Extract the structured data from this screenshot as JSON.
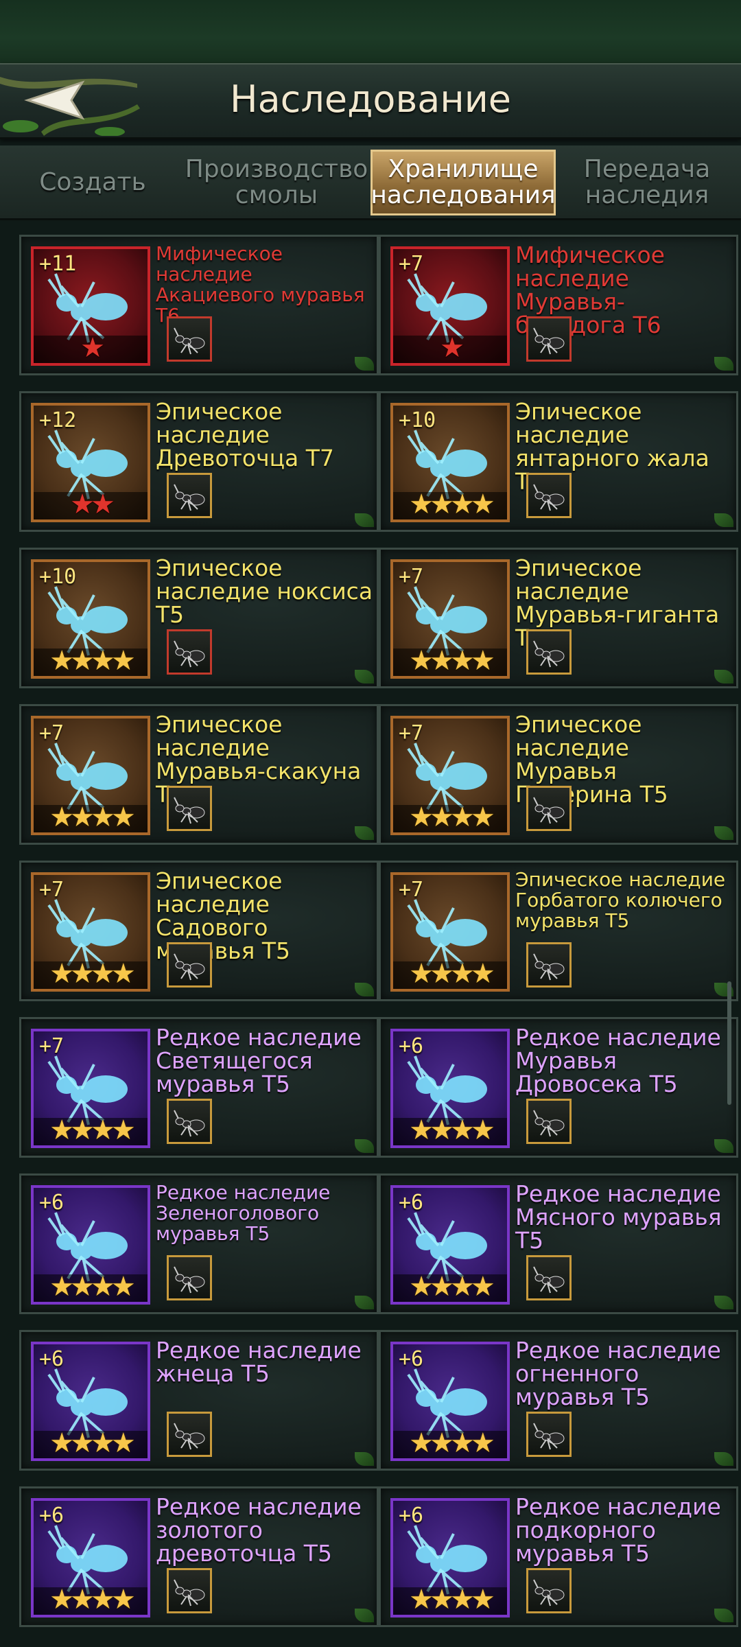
{
  "header": {
    "title": "Наследование",
    "back_icon": "back-arrow-icon"
  },
  "tabs": [
    {
      "label": "Создать",
      "active": false
    },
    {
      "label": "Производство смолы",
      "active": false
    },
    {
      "label": "Хранилище наследования",
      "active": true
    },
    {
      "label": "Передача наследия",
      "active": false
    }
  ],
  "colors": {
    "mythic": "#e13a35",
    "epic": "#f3e36a",
    "rare": "#dea3ff",
    "star_gold": "#f7c64a",
    "star_red": "#e0342c"
  },
  "items": [
    {
      "name": "Мифическое наследие Акациевого муравья Т6",
      "level": "+11",
      "rarity": "mythic",
      "stars": 1,
      "star_color": "red"
    },
    {
      "name": "Мифическое наследие Муравья-бульдога Т6",
      "level": "+7",
      "rarity": "mythic",
      "stars": 1,
      "star_color": "red"
    },
    {
      "name": "Эпическое наследие Древоточца Т7",
      "level": "+12",
      "rarity": "epic",
      "stars": 2,
      "star_color": "red"
    },
    {
      "name": "Эпическое наследие янтарного жала Т5",
      "level": "+10",
      "rarity": "epic",
      "stars": 4,
      "star_color": "gold"
    },
    {
      "name": "Эпическое наследие ноксиса Т5",
      "level": "+10",
      "rarity": "epic",
      "stars": 4,
      "star_color": "gold"
    },
    {
      "name": "Эпическое наследие Муравья-гиганта Т5",
      "level": "+7",
      "rarity": "epic",
      "stars": 4,
      "star_color": "gold"
    },
    {
      "name": "Эпическое наследие Муравья-скакуна Т5",
      "level": "+7",
      "rarity": "epic",
      "stars": 4,
      "star_color": "gold"
    },
    {
      "name": "Эпическое наследие Муравья Понерина Т5",
      "level": "+7",
      "rarity": "epic",
      "stars": 4,
      "star_color": "gold"
    },
    {
      "name": "Эпическое наследие Садового муравья Т5",
      "level": "+7",
      "rarity": "epic",
      "stars": 4,
      "star_color": "gold"
    },
    {
      "name": "Эпическое наследие Горбатого колючего муравья Т5",
      "level": "+7",
      "rarity": "epic",
      "stars": 4,
      "star_color": "gold"
    },
    {
      "name": "Редкое наследие Светящегося муравья Т5",
      "level": "+7",
      "rarity": "rare",
      "stars": 4,
      "star_color": "gold"
    },
    {
      "name": "Редкое наследие Муравья Дровосека Т5",
      "level": "+6",
      "rarity": "rare",
      "stars": 4,
      "star_color": "gold"
    },
    {
      "name": "Редкое наследие Зеленоголового муравья Т5",
      "level": "+6",
      "rarity": "rare",
      "stars": 4,
      "star_color": "gold"
    },
    {
      "name": "Редкое наследие Мясного муравья Т5",
      "level": "+6",
      "rarity": "rare",
      "stars": 4,
      "star_color": "gold"
    },
    {
      "name": "Редкое наследие жнеца Т5",
      "level": "+6",
      "rarity": "rare",
      "stars": 4,
      "star_color": "gold"
    },
    {
      "name": "Редкое наследие огненного муравья Т5",
      "level": "+6",
      "rarity": "rare",
      "stars": 4,
      "star_color": "gold"
    },
    {
      "name": "Редкое наследие золотого древоточца Т5",
      "level": "+6",
      "rarity": "rare",
      "stars": 4,
      "star_color": "gold"
    },
    {
      "name": "Редкое наследие подкорного муравья Т5",
      "level": "+6",
      "rarity": "rare",
      "stars": 4,
      "star_color": "gold"
    }
  ]
}
